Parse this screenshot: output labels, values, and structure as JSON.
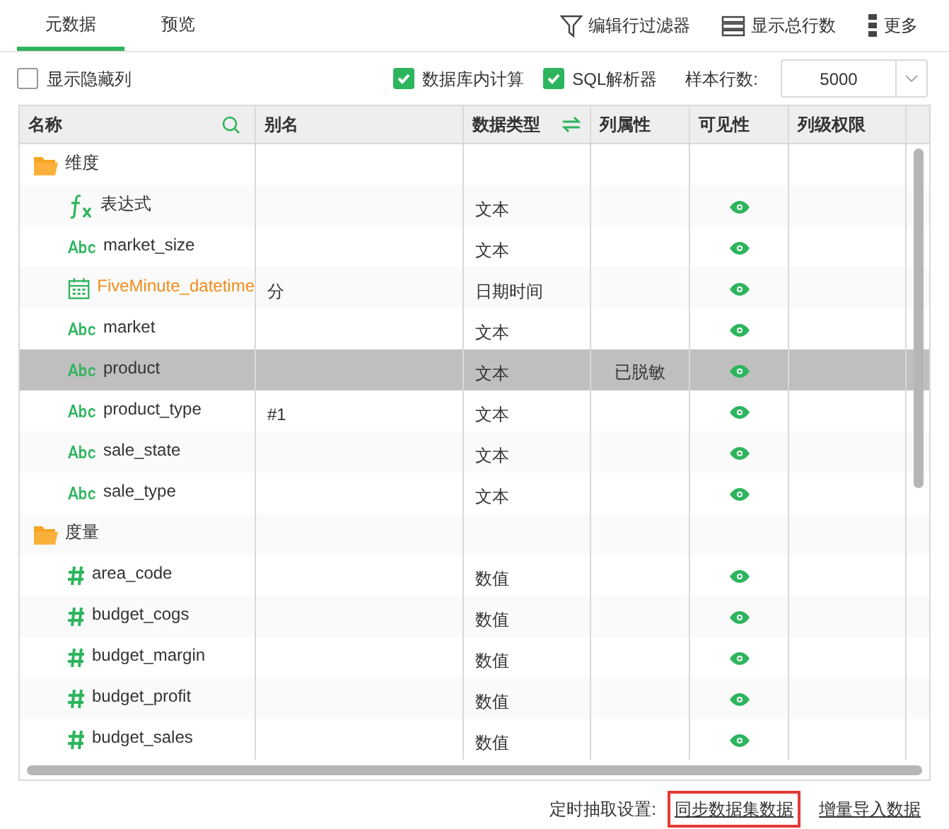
{
  "tabs": [
    {
      "label": "元数据",
      "selected": true
    },
    {
      "label": "预览",
      "selected": false
    }
  ],
  "toolbar": [
    {
      "kind": "filter",
      "label": "编辑行过滤器"
    },
    {
      "kind": "rows",
      "label": "显示总行数"
    },
    {
      "kind": "more",
      "label": "更多"
    }
  ],
  "options": {
    "show_hidden": {
      "label": "显示隐藏列",
      "checked": false
    },
    "db_compute": {
      "label": "数据库内计算",
      "checked": true
    },
    "sql_parser": {
      "label": "SQL解析器",
      "checked": true
    },
    "sample_rows": {
      "label": "样本行数:",
      "value": "5000"
    }
  },
  "table": {
    "columns": [
      "名称",
      "别名",
      "数据类型",
      "列属性",
      "可见性",
      "列级权限"
    ],
    "rows": [
      {
        "kind": "group",
        "name": "维度",
        "selected": false
      },
      {
        "kind": "expr",
        "name": "表达式",
        "type": "文本",
        "visible": true,
        "selected": false,
        "highlighted": false
      },
      {
        "kind": "text",
        "name": "market_size",
        "type": "文本",
        "visible": true,
        "selected": false,
        "highlighted": false
      },
      {
        "kind": "date",
        "name": "FiveMinute_datetime",
        "alias": "分",
        "type": "日期时间",
        "visible": true,
        "selected": false,
        "highlighted": true
      },
      {
        "kind": "text",
        "name": "market",
        "type": "文本",
        "visible": true,
        "selected": false,
        "highlighted": false
      },
      {
        "kind": "text",
        "name": "product",
        "type": "文本",
        "attr": "已脱敏",
        "visible": true,
        "selected": true,
        "highlighted": false
      },
      {
        "kind": "text",
        "name": "product_type",
        "alias": "#1",
        "type": "文本",
        "visible": true,
        "selected": false,
        "highlighted": false
      },
      {
        "kind": "text",
        "name": "sale_state",
        "type": "文本",
        "visible": true,
        "selected": false,
        "highlighted": false
      },
      {
        "kind": "text",
        "name": "sale_type",
        "type": "文本",
        "visible": true,
        "selected": false,
        "highlighted": false
      },
      {
        "kind": "group",
        "name": "度量",
        "selected": false
      },
      {
        "kind": "number",
        "name": "area_code",
        "type": "数值",
        "visible": true,
        "selected": false,
        "highlighted": false
      },
      {
        "kind": "number",
        "name": "budget_cogs",
        "type": "数值",
        "visible": true,
        "selected": false,
        "highlighted": false
      },
      {
        "kind": "number",
        "name": "budget_margin",
        "type": "数值",
        "visible": true,
        "selected": false,
        "highlighted": false
      },
      {
        "kind": "number",
        "name": "budget_profit",
        "type": "数值",
        "visible": true,
        "selected": false,
        "highlighted": false
      },
      {
        "kind": "number",
        "name": "budget_sales",
        "type": "数值",
        "visible": true,
        "selected": false,
        "highlighted": false
      }
    ]
  },
  "footer": {
    "label": "定时抽取设置:",
    "links": [
      {
        "label": "同步数据集数据",
        "highlighted": true
      },
      {
        "label": "增量导入数据",
        "highlighted": false
      }
    ]
  }
}
